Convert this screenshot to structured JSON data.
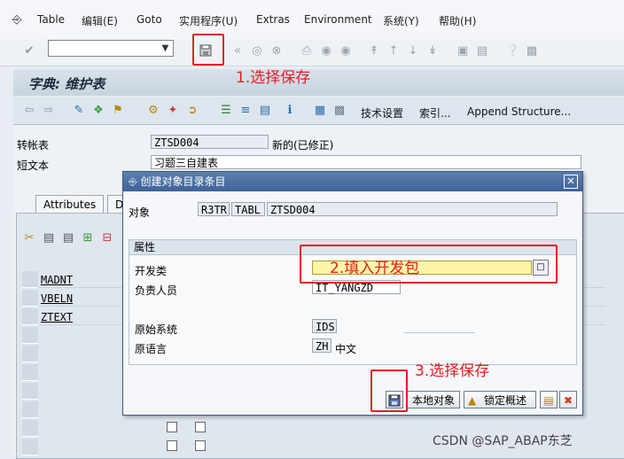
{
  "menubar": {
    "items": [
      "Table",
      "编辑(E)",
      "Goto",
      "实用程序(U)",
      "Extras",
      "Environment",
      "系统(Y)",
      "帮助(H)"
    ]
  },
  "screen": {
    "title": "字典: 维护表"
  },
  "app_toolbar": {
    "tech_settings": "技术设置",
    "index": "索引...",
    "append_structure": "Append Structure..."
  },
  "form": {
    "table_label": "转帐表",
    "table_value": "ZTSD004",
    "table_status": "新的(已修正)",
    "short_text_label": "短文本",
    "short_text_value": "习题三自建表"
  },
  "tabs": [
    "Attributes",
    "D"
  ],
  "fields": [
    "MADNT",
    "VBELN",
    "ZTEXT"
  ],
  "dialog": {
    "title": "创建对象目录条目",
    "object_label": "对象",
    "object_parts": [
      "R3TR",
      "TABL",
      "ZTSD004"
    ],
    "group_title": "属性",
    "package_label": "开发类",
    "package_value": "",
    "owner_label": "负责人员",
    "owner_value": "IT_YANGZD",
    "source_system_label": "原始系统",
    "source_system_value": "IDS",
    "language_label": "原语言",
    "language_value": "ZH",
    "language_name": "中文",
    "local_object_label": "本地对象",
    "lock_overview_label": "锁定概述"
  },
  "annotations": {
    "step1": "1.选择保存",
    "step2": "2.填入开发包",
    "step3": "3.选择保存"
  },
  "watermark": "CSDN @SAP_ABAP东芝",
  "colors": {
    "annotation_red": "#e02020",
    "dialog_title_blue": "#3f639a",
    "package_field_yellow": "#fff5a8"
  }
}
